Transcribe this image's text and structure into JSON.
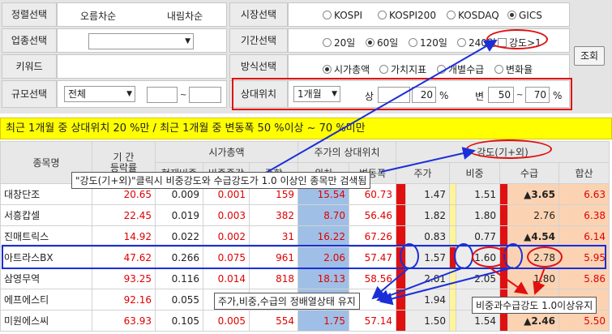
{
  "filters": {
    "sort_label": "정렬선택",
    "sort_asc": "오름차순",
    "sort_desc": "내림차순",
    "market_label": "시장선택",
    "markets": [
      "KOSPI",
      "KOSPI200",
      "KOSDAQ",
      "GICS"
    ],
    "industry_label": "업종선택",
    "period_label": "기간선택",
    "periods": [
      "20일",
      "60일",
      "120일",
      "240일"
    ],
    "strength_check": "강도>1",
    "keyword_label": "키워드",
    "method_label": "방식선택",
    "methods": [
      "시가총액",
      "가치지표",
      "개별수급",
      "변화율"
    ],
    "size_label": "규모선택",
    "size_value": "전체",
    "size_tilde": "~",
    "relpos_label": "상대위치",
    "relpos_period": "1개월",
    "upper_label": "상",
    "upper_value": "20",
    "pct1": "%",
    "change_label": "변",
    "change_from": "50",
    "change_tilde": "~",
    "change_to": "70",
    "pct2": "%",
    "query_button": "조회"
  },
  "banner": "최근 1개월 중 상대위치 20 %만 / 최근 1개월 중 변동폭 50 %이상 ~ 70 %미만",
  "table": {
    "headers": {
      "name": "종목명",
      "period_return": "기 간\n등락률",
      "market_cap": "시가총액",
      "cur_weight": "현재비중",
      "weight_change": "비중증감",
      "stock_rank": "종합",
      "relpos": "주가의 상대위치",
      "position": "위치",
      "volatility": "변동폭",
      "strength": "강도(기+외)",
      "price": "주가",
      "weight": "비중",
      "supply": "수급",
      "sum": "합산"
    },
    "rows": [
      {
        "name": "대창단조",
        "ret": "20.65",
        "cw": "0.009",
        "wc": "0.001",
        "rank": "159",
        "pos": "15.54",
        "vol": "60.73",
        "price": "1.47",
        "weight": "1.51",
        "supply": "▲3.65",
        "sum": "6.63"
      },
      {
        "name": "서흥캅셀",
        "ret": "22.45",
        "cw": "0.019",
        "wc": "0.003",
        "rank": "382",
        "pos": "8.70",
        "vol": "56.46",
        "price": "1.82",
        "weight": "1.80",
        "supply": "2.76",
        "sum": "6.38"
      },
      {
        "name": "진매트릭스",
        "ret": "14.92",
        "cw": "0.022",
        "wc": "0.002",
        "rank": "31",
        "pos": "16.22",
        "vol": "67.26",
        "price": "0.83",
        "weight": "0.77",
        "supply": "▲4.54",
        "sum": "6.14"
      },
      {
        "name": "아트라스BX",
        "ret": "47.62",
        "cw": "0.266",
        "wc": "0.075",
        "rank": "961",
        "pos": "2.06",
        "vol": "57.47",
        "price": "1.57",
        "weight": "1.60",
        "supply": "2.78",
        "sum": "5.95"
      },
      {
        "name": "삼영무역",
        "ret": "93.25",
        "cw": "0.116",
        "wc": "0.014",
        "rank": "818",
        "pos": "18.13",
        "vol": "58.56",
        "price": "2.01",
        "weight": "2.05",
        "supply": "1.80",
        "sum": "5.86"
      },
      {
        "name": "에프에스티",
        "ret": "92.16",
        "cw": "0.055",
        "wc": "",
        "rank": "",
        "pos": "",
        "vol": "",
        "price": "1.94",
        "weight": "",
        "supply": "",
        "sum": ""
      },
      {
        "name": "미원에스씨",
        "ret": "63.93",
        "cw": "0.105",
        "wc": "0.005",
        "rank": "554",
        "pos": "1.75",
        "vol": "57.14",
        "price": "1.50",
        "weight": "1.54",
        "supply": "▲2.46",
        "sum": "5.50"
      }
    ]
  },
  "annotations": {
    "note1": "\"강도(기+외)\"클릭시 비중강도와 수급강도가 1.0 이상인 종목만 검색됨",
    "note2": "주가,비중,수급의 정배열상태 유지",
    "note3": "비중과수급강도 1.0이상유지"
  },
  "colors": {
    "accent_red": "#e01010",
    "annotation_blue": "#1a2fd8",
    "banner_yellow": "#ffff00"
  }
}
